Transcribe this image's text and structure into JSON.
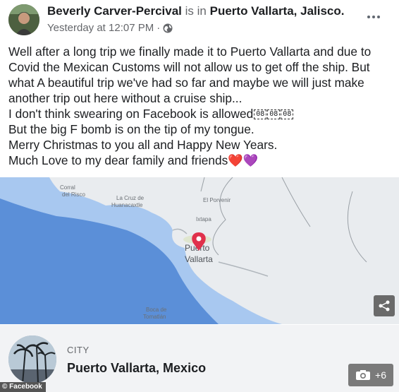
{
  "post": {
    "author": "Beverly Carver-Percival",
    "is_in": "is in",
    "location": "Puerto Vallarta, Jalisco.",
    "timestamp": "Yesterday at 12:07 PM",
    "separator": "·",
    "privacy_icon": "globe-icon",
    "more_icon": "more-options-icon",
    "lines": [
      "Well after a long trip we finally made it to Puerto Vallarta and due to",
      "Covid the Mexican Customs will not allow us to get off the ship. But",
      "what A  beautiful trip we've had so far and maybe we will just make",
      "another trip out here without a cruise ship...",
      "I don't think swearing on Facebook is allowed",
      "But the big F bomb is on the tip of my tongue.",
      "Merry Christmas to you all and Happy New Years.",
      "Much Love to my dear family and friends"
    ],
    "emoji_placeholders": [
      "08",
      "08",
      "08"
    ],
    "heart_red": "❤️",
    "heart_purple": "💜"
  },
  "map": {
    "labels": {
      "corral": "Corral\ndel Risco",
      "cruz": "La Cruz de\nHuanacaxtle",
      "porvenir": "El Porvenir",
      "ixtapa": "Ixtapa",
      "city": "Puerto\nVallarta",
      "boca": "Boca de\nTomatlán"
    },
    "share_icon": "share-icon",
    "colors": {
      "water": "#a8c8f0",
      "deep": "#5b8fd8",
      "land": "#e9ecef"
    }
  },
  "place": {
    "kind": "CITY",
    "name": "Puerto Vallarta, Mexico",
    "photo_count": "+6",
    "camera_icon": "camera-icon"
  },
  "watermark": "© Facebook"
}
